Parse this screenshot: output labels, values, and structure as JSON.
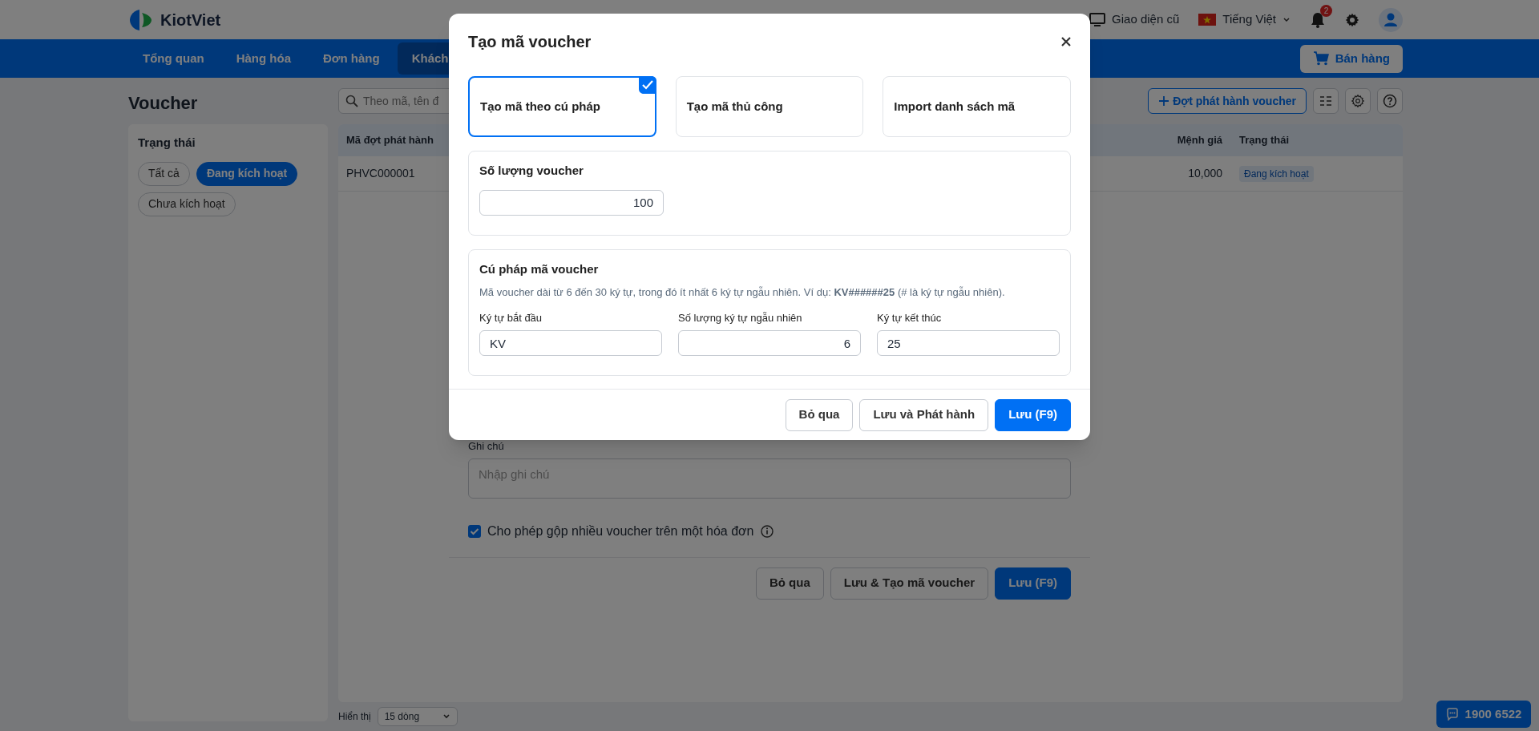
{
  "header": {
    "logo": "KiotViet",
    "old_ui": "Giao diện cũ",
    "language": "Tiếng Việt",
    "notification_count": "2"
  },
  "nav": {
    "items": [
      {
        "label": "Tổng quan",
        "selected": false
      },
      {
        "label": "Hàng hóa",
        "selected": false
      },
      {
        "label": "Đơn hàng",
        "selected": false
      },
      {
        "label": "Khách",
        "selected": true
      }
    ],
    "sell_button": "Bán hàng"
  },
  "page": {
    "title": "Voucher",
    "search_placeholder": "Theo mã, tên đ",
    "add_button": "Đợt phát hành voucher"
  },
  "filter": {
    "title": "Trạng thái",
    "chips": [
      {
        "label": "Tất cả",
        "selected": false
      },
      {
        "label": "Đang kích hoạt",
        "selected": true
      },
      {
        "label": "Chưa kích hoạt",
        "selected": false
      }
    ]
  },
  "table": {
    "columns": [
      "Mã đợt phát hành",
      "Mệnh giá",
      "Trạng thái"
    ],
    "rows": [
      {
        "code": "PHVC000001",
        "value": "10,000",
        "status": "Đang kích hoạt"
      }
    ]
  },
  "pagination": {
    "label": "Hiển thị",
    "page_size": "15 dòng"
  },
  "hotline": "1900 6522",
  "issue_dialog": {
    "note_label": "Ghi chú",
    "note_placeholder": "Nhập ghi chú",
    "allow_combine": {
      "label": "Cho phép gộp nhiều voucher trên một hóa đơn",
      "checked": true
    },
    "buttons": [
      {
        "label": "Bỏ qua",
        "kind": "secondary"
      },
      {
        "label": "Lưu & Tạo mã voucher",
        "kind": "secondary"
      },
      {
        "label": "Lưu (F9)",
        "kind": "primary"
      }
    ]
  },
  "modal": {
    "title": "Tạo mã voucher",
    "modes": [
      {
        "label": "Tạo mã theo cú pháp",
        "selected": true
      },
      {
        "label": "Tạo mã thủ công",
        "selected": false
      },
      {
        "label": "Import danh sách mã",
        "selected": false
      }
    ],
    "quantity": {
      "label": "Số lượng voucher",
      "value": "100"
    },
    "syntax": {
      "title": "Cú pháp mã voucher",
      "hint": "Mã voucher dài từ 6 đến 30 ký tự, trong đó ít nhất 6 ký tự ngẫu nhiên. Ví dụ: **KV######25** (# là ký tự ngẫu nhiên).",
      "fields": [
        {
          "label": "Ký tự bắt đầu",
          "value": "KV",
          "kind": "text"
        },
        {
          "label": "Số lượng ký tự ngẫu nhiên",
          "value": "6",
          "kind": "number"
        },
        {
          "label": "Ký tự kết thúc",
          "value": "25",
          "kind": "text"
        }
      ]
    },
    "buttons": [
      {
        "label": "Bỏ qua",
        "kind": "secondary"
      },
      {
        "label": "Lưu và Phát hành",
        "kind": "secondary"
      },
      {
        "label": "Lưu (F9)",
        "kind": "primary"
      }
    ]
  }
}
